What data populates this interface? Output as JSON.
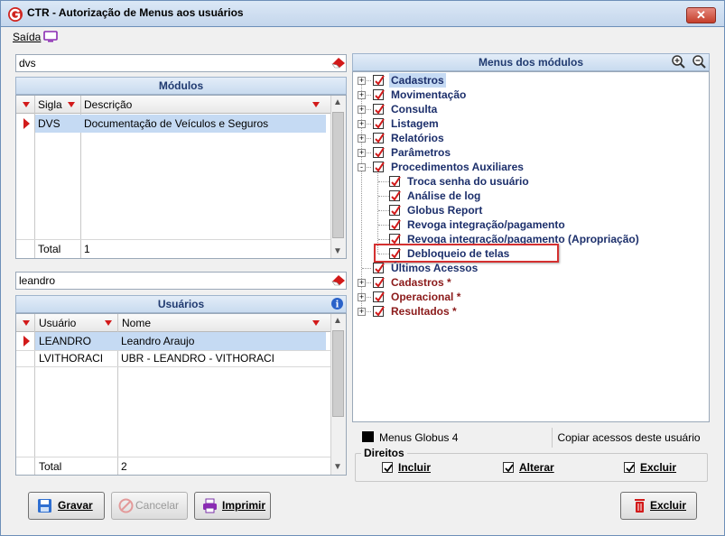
{
  "window": {
    "title": "CTR - Autorização de Menus aos usuários",
    "close_label": "✕"
  },
  "menu": {
    "saida": "Saída"
  },
  "modulos": {
    "filter_value": "dvs",
    "header": "Módulos",
    "columns": [
      "Sigla",
      "Descrição"
    ],
    "rows": [
      {
        "sigla": "DVS",
        "descricao": "Documentação de Veículos e Seguros"
      }
    ],
    "total_label": "Total",
    "total_value": "1"
  },
  "usuarios": {
    "filter_value": "leandro",
    "header": "Usuários",
    "columns": [
      "Usuário",
      "Nome"
    ],
    "rows": [
      {
        "usuario": "LEANDRO",
        "nome": "Leandro Araujo"
      },
      {
        "usuario": "LVITHORACI",
        "nome": "UBR - LEANDRO - VITHORACI"
      }
    ],
    "total_label": "Total",
    "total_value": "2"
  },
  "menus": {
    "header": "Menus dos módulos",
    "tree": [
      {
        "label": "Cadastros",
        "level": 0,
        "exp": "+",
        "checked": true,
        "selected": true,
        "color": "#1c2f6b"
      },
      {
        "label": "Movimentação",
        "level": 0,
        "exp": "+",
        "checked": true,
        "color": "#1c2f6b"
      },
      {
        "label": "Consulta",
        "level": 0,
        "exp": "+",
        "checked": true,
        "color": "#1c2f6b"
      },
      {
        "label": "Listagem",
        "level": 0,
        "exp": "+",
        "checked": true,
        "color": "#1c2f6b"
      },
      {
        "label": "Relatórios",
        "level": 0,
        "exp": "+",
        "checked": true,
        "color": "#1c2f6b"
      },
      {
        "label": "Parâmetros",
        "level": 0,
        "exp": "+",
        "checked": true,
        "color": "#1c2f6b"
      },
      {
        "label": "Procedimentos Auxiliares",
        "level": 0,
        "exp": "-",
        "checked": true,
        "color": "#1c2f6b"
      },
      {
        "label": "Troca senha do usuário",
        "level": 1,
        "exp": "",
        "checked": true,
        "color": "#1c2f6b"
      },
      {
        "label": "Análise de log",
        "level": 1,
        "exp": "",
        "checked": true,
        "color": "#1c2f6b"
      },
      {
        "label": "Globus Report",
        "level": 1,
        "exp": "",
        "checked": true,
        "color": "#1c2f6b"
      },
      {
        "label": "Revoga integração/pagamento",
        "level": 1,
        "exp": "",
        "checked": true,
        "color": "#1c2f6b"
      },
      {
        "label": "Revoga integração/pagamento (Apropriação)",
        "level": 1,
        "exp": "",
        "checked": true,
        "color": "#1c2f6b"
      },
      {
        "label": "Debloqueio de telas",
        "level": 1,
        "exp": "",
        "checked": true,
        "color": "#1c2f6b",
        "highlight": true
      },
      {
        "label": "Últimos Acessos",
        "level": 0,
        "exp": "",
        "checked": true,
        "color": "#1c2f6b"
      },
      {
        "label": "Cadastros *",
        "level": 0,
        "exp": "+",
        "checked": true,
        "color": "#8b1a1a"
      },
      {
        "label": "Operacional *",
        "level": 0,
        "exp": "+",
        "checked": true,
        "color": "#8b1a1a"
      },
      {
        "label": "Resultados *",
        "level": 0,
        "exp": "+",
        "checked": true,
        "color": "#8b1a1a"
      }
    ],
    "legend_label": "Menus Globus 4",
    "copy_label": "Copiar acessos deste usuário"
  },
  "direitos": {
    "title": "Direitos",
    "incluir": "Incluir",
    "alterar": "Alterar",
    "excluir": "Excluir"
  },
  "buttons": {
    "gravar": "Gravar",
    "cancelar": "Cancelar",
    "imprimir": "Imprimir",
    "excluir": "Excluir"
  },
  "colors": {
    "accent": "#203a70",
    "selection": "#c5daf3",
    "highlight_box": "#d43030"
  }
}
